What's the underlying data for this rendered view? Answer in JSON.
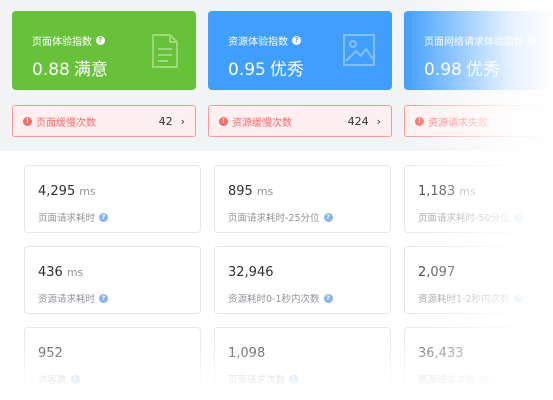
{
  "score_cards": [
    {
      "title": "页面体验指数",
      "value": "0.88",
      "grade": "满意",
      "icon": "document-icon",
      "color": "#67c23a"
    },
    {
      "title": "资源体验指数",
      "value": "0.95",
      "grade": "优秀",
      "icon": "image-icon",
      "color": "#409eff"
    },
    {
      "title": "页面网络请求体验指数",
      "value": "0.98",
      "grade": "优秀",
      "icon": "network-icon",
      "color": "#409eff"
    }
  ],
  "alerts": [
    {
      "label": "页面缓慢次数",
      "count": "42",
      "arrow": "›"
    },
    {
      "label": "资源缓慢次数",
      "count": "424",
      "arrow": "›"
    },
    {
      "label": "资源请求失败",
      "count": "",
      "arrow": ""
    }
  ],
  "help_glyph": "?",
  "alert_glyph": "!",
  "metrics": [
    {
      "value": "4,295",
      "unit": "ms",
      "label": "页面请求耗时"
    },
    {
      "value": "895",
      "unit": "ms",
      "label": "页面请求耗时-25分位"
    },
    {
      "value": "1,183",
      "unit": "ms",
      "label": "页面请求耗时-50分位"
    },
    {
      "value": "436",
      "unit": "ms",
      "label": "资源请求耗时"
    },
    {
      "value": "32,946",
      "unit": "",
      "label": "资源耗时0-1秒内次数"
    },
    {
      "value": "2,097",
      "unit": "",
      "label": "资源耗时1-2秒内次数"
    },
    {
      "value": "952",
      "unit": "",
      "label": "访客数"
    },
    {
      "value": "1,098",
      "unit": "",
      "label": "页面请求次数"
    },
    {
      "value": "36,433",
      "unit": "",
      "label": "资源请求次数"
    }
  ],
  "colors": {
    "green": "#67c23a",
    "blue": "#409eff",
    "alert_red": "#f56c6c",
    "alert_bg": "#fef0f0"
  }
}
